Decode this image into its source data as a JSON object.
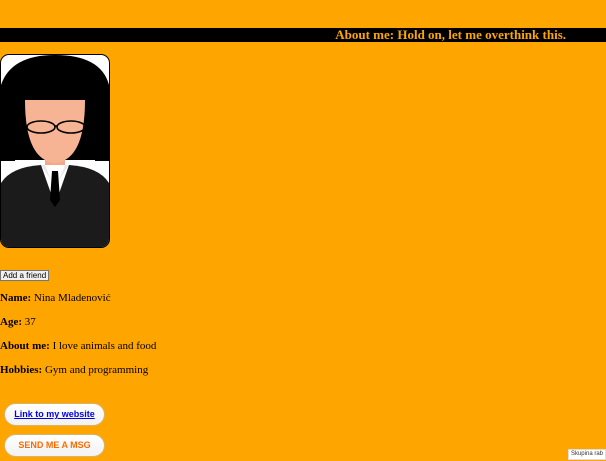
{
  "banner": {
    "text": "About me: Hold on, let me overthink this."
  },
  "profile": {
    "add_friend_label": "Add a friend",
    "name": {
      "label": "Name:",
      "value": " Nina Mladenović"
    },
    "age": {
      "label": "Age:",
      "value": " 37"
    },
    "about": {
      "label": "About me:",
      "value": " I love animals and food"
    },
    "hobbies": {
      "label": "Hobbies:",
      "value": " Gym and programming"
    }
  },
  "links": {
    "website_label": "Link to my website",
    "message_label": "SEND ME A MSG"
  },
  "corner": {
    "label": "Skupina rab"
  },
  "colors": {
    "background": "#FFA500",
    "banner_bg": "#000000",
    "banner_text": "#FFA500",
    "link": "#0000EE",
    "msg_text": "#FF6A00"
  }
}
